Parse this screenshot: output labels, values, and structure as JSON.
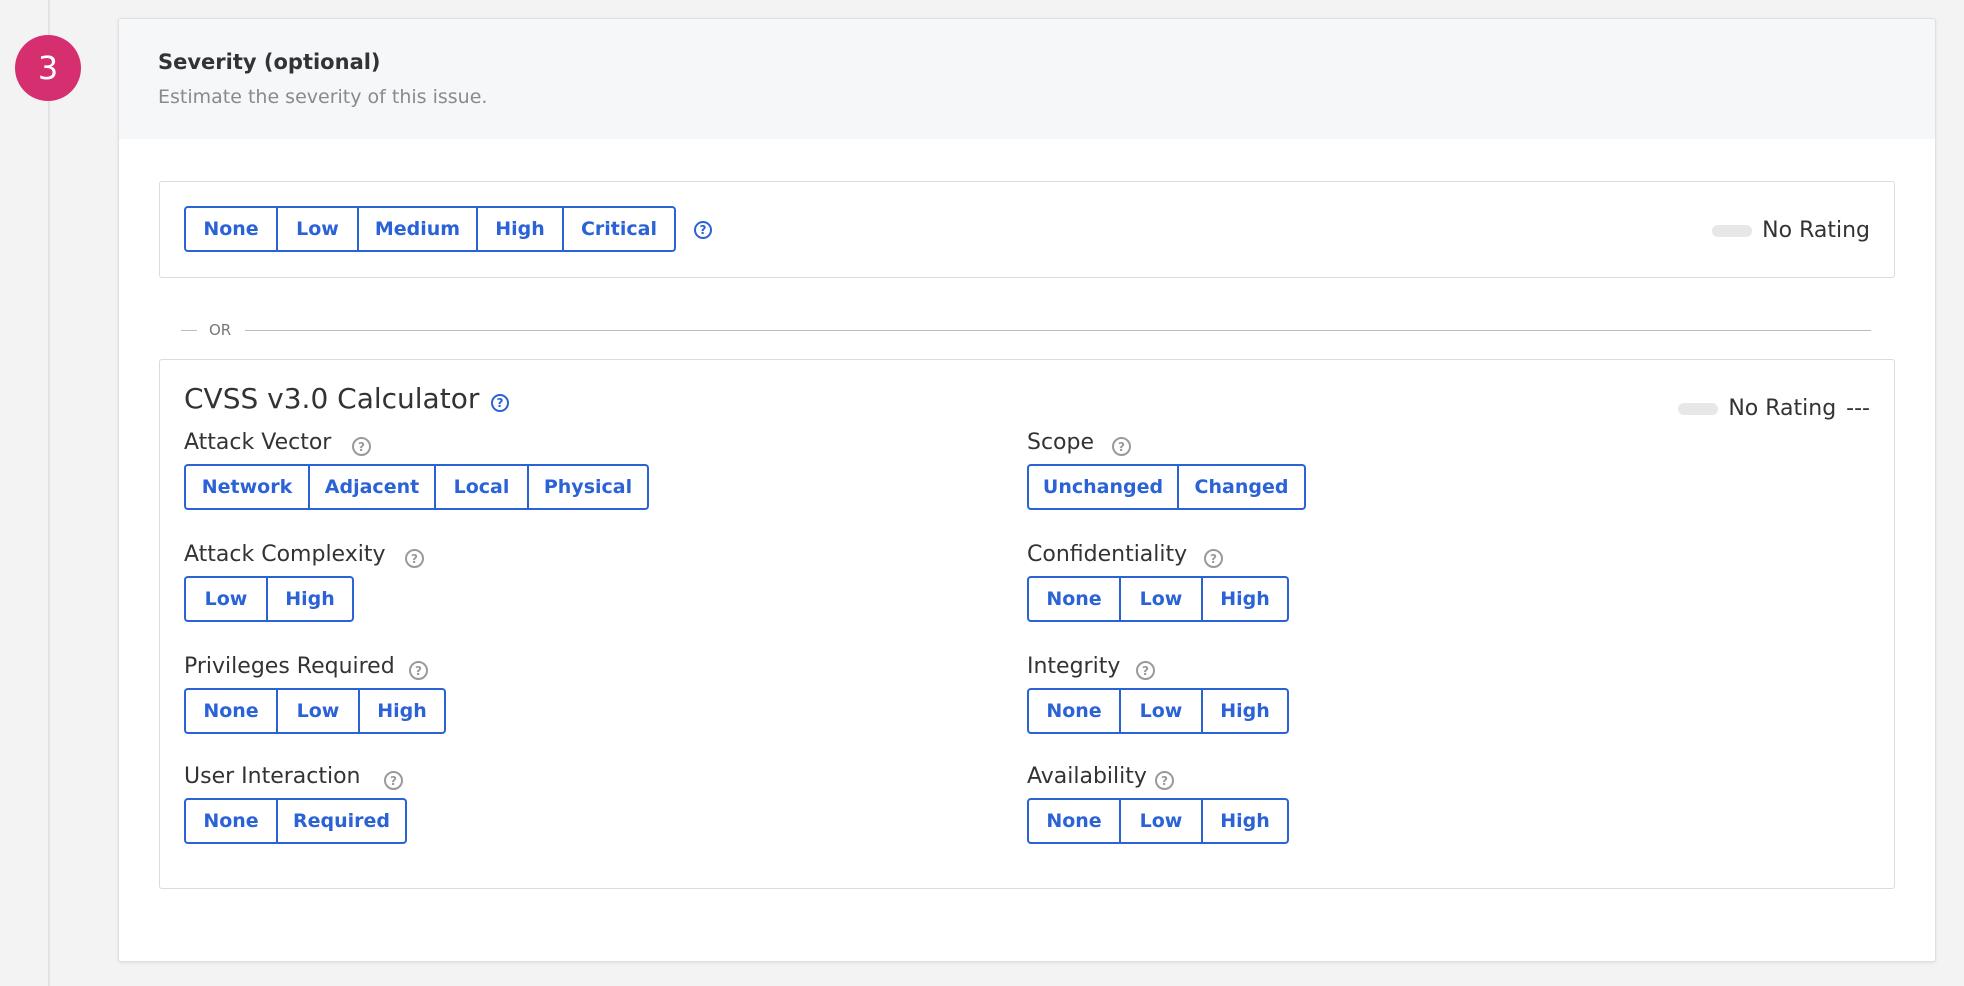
{
  "step": {
    "number": "3"
  },
  "section": {
    "title": "Severity (optional)",
    "subtitle": "Estimate the severity of this issue."
  },
  "quick_rating": {
    "options": [
      "None",
      "Low",
      "Medium",
      "High",
      "Critical"
    ],
    "help_icon": "question-circle-icon",
    "rating_text": "No Rating"
  },
  "divider": {
    "label": "OR"
  },
  "cvss": {
    "title": "CVSS v3.0 Calculator",
    "help_icon": "question-circle-icon",
    "rating_text": "No Rating",
    "score_text": "---",
    "metrics": {
      "attack_vector": {
        "label": "Attack Vector",
        "options": [
          "Network",
          "Adjacent",
          "Local",
          "Physical"
        ]
      },
      "attack_complexity": {
        "label": "Attack Complexity",
        "options": [
          "Low",
          "High"
        ]
      },
      "privileges_required": {
        "label": "Privileges Required",
        "options": [
          "None",
          "Low",
          "High"
        ]
      },
      "user_interaction": {
        "label": "User Interaction",
        "options": [
          "None",
          "Required"
        ]
      },
      "scope": {
        "label": "Scope",
        "options": [
          "Unchanged",
          "Changed"
        ]
      },
      "confidentiality": {
        "label": "Confidentiality",
        "options": [
          "None",
          "Low",
          "High"
        ]
      },
      "integrity": {
        "label": "Integrity",
        "options": [
          "None",
          "Low",
          "High"
        ]
      },
      "availability": {
        "label": "Availability",
        "options": [
          "None",
          "Low",
          "High"
        ]
      }
    }
  },
  "colors": {
    "accent": "#2b62d6",
    "step_badge": "#d52f6f",
    "header_bg": "#f6f7f8",
    "muted_text": "#8a8a8a"
  }
}
